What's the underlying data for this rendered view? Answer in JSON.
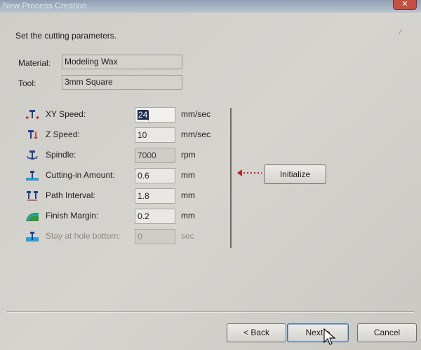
{
  "window": {
    "title": "New Process Creation",
    "close_glyph": "✕"
  },
  "header": {
    "instruction": "Set the cutting parameters."
  },
  "info": {
    "material_label": "Material:",
    "material_value": "Modeling Wax",
    "tool_label": "Tool:",
    "tool_value": "3mm Square"
  },
  "params": {
    "xy_speed": {
      "label": "XY Speed:",
      "value": "24",
      "unit": "mm/sec",
      "icon": "xy-speed-icon"
    },
    "z_speed": {
      "label": "Z Speed:",
      "value": "10",
      "unit": "mm/sec",
      "icon": "z-speed-icon"
    },
    "spindle": {
      "label": "Spindle:",
      "value": "7000",
      "unit": "rpm",
      "icon": "spindle-icon"
    },
    "cutting_in": {
      "label": "Cutting-in Amount:",
      "value": "0.6",
      "unit": "mm",
      "icon": "cutting-in-icon"
    },
    "path_interval": {
      "label": "Path Interval:",
      "value": "1.8",
      "unit": "mm",
      "icon": "path-interval-icon"
    },
    "finish_margin": {
      "label": "Finish Margin:",
      "value": "0.2",
      "unit": "mm",
      "icon": "finish-margin-icon"
    },
    "stay_hole": {
      "label": "Stay at hole bottom:",
      "value": "0",
      "unit": "sec",
      "icon": "stay-hole-icon"
    }
  },
  "buttons": {
    "initialize": "Initialize",
    "back": "< Back",
    "next": "Next >",
    "cancel": "Cancel"
  },
  "colors": {
    "accent_arrow": "#b3262a",
    "tool_icon": "#1f3f8f",
    "finish_icon": "#2e9a3a"
  }
}
